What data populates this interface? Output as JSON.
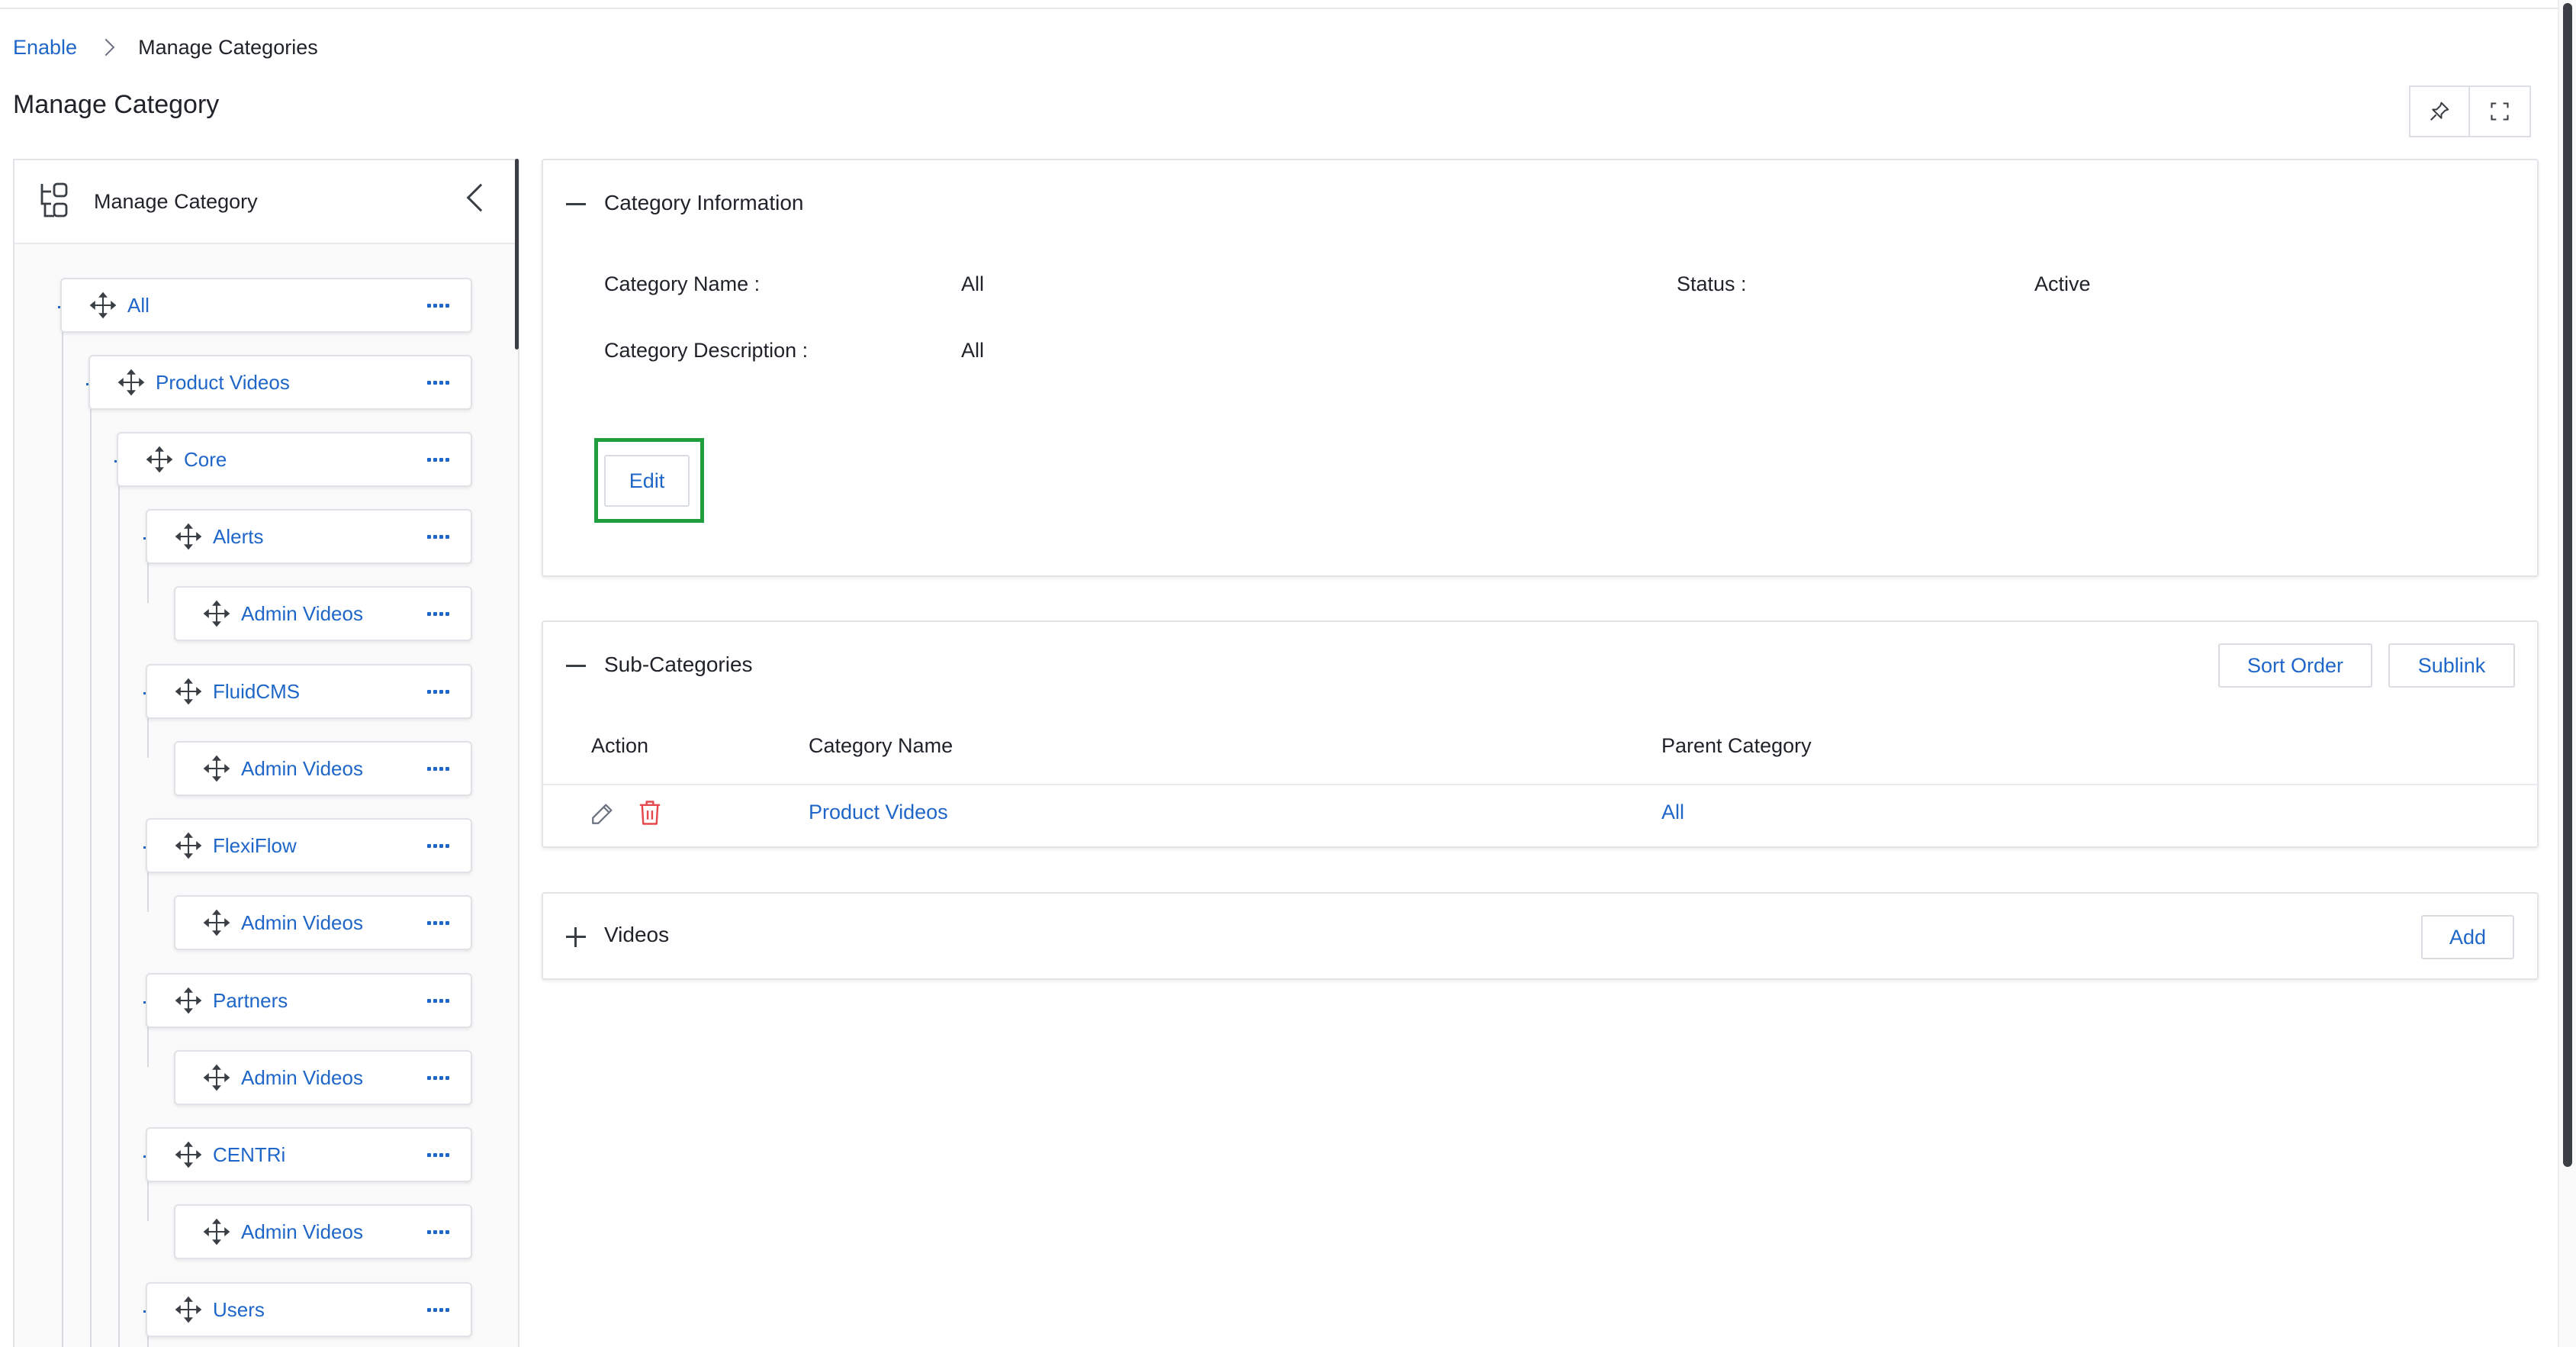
{
  "breadcrumb": {
    "root": "Enable",
    "current": "Manage Categories"
  },
  "page": {
    "title": "Manage Category"
  },
  "toolbar": {
    "pin_icon": "pin-icon",
    "fullscreen_icon": "fullscreen-icon"
  },
  "tree_panel": {
    "title": "Manage Category",
    "header_icon": "hierarchy-icon",
    "nodes": [
      {
        "label": "All"
      },
      {
        "label": "Product Videos"
      },
      {
        "label": "Core"
      },
      {
        "label": "Alerts"
      },
      {
        "label": "Admin Videos"
      },
      {
        "label": "FluidCMS"
      },
      {
        "label": "Admin Videos"
      },
      {
        "label": "FlexiFlow"
      },
      {
        "label": "Admin Videos"
      },
      {
        "label": "Partners"
      },
      {
        "label": "Admin Videos"
      },
      {
        "label": "CENTRi"
      },
      {
        "label": "Admin Videos"
      },
      {
        "label": "Users"
      }
    ]
  },
  "category_info": {
    "title": "Category Information",
    "name_label": "Category Name :",
    "name_value": "All",
    "status_label": "Status :",
    "status_value": "Active",
    "description_label": "Category Description :",
    "description_value": "All",
    "edit_label": "Edit"
  },
  "subcategories": {
    "title": "Sub-Categories",
    "sort_order_label": "Sort Order",
    "sublink_label": "Sublink",
    "columns": [
      "Action",
      "Category Name",
      "Parent Category"
    ],
    "rows": [
      {
        "category_name": "Product Videos",
        "parent_category": "All"
      }
    ]
  },
  "videos": {
    "title": "Videos",
    "add_label": "Add"
  },
  "colors": {
    "accent": "#1f66c9",
    "highlight": "#1e9e3d",
    "delete": "#e5484d"
  }
}
